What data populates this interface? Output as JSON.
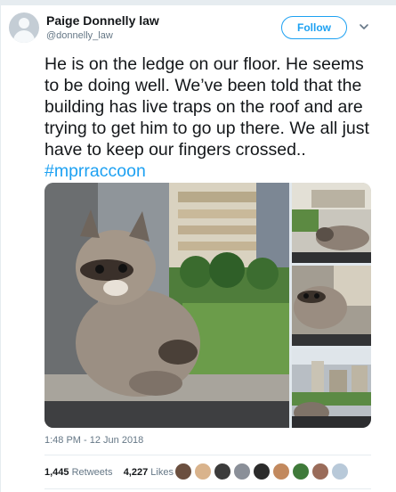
{
  "tweet": {
    "author_name": "Paige Donnelly law",
    "author_handle": "@donnelly_law",
    "follow_label": "Follow",
    "text": "He is on the ledge on our floor. He seems to be doing well. We’ve been told that the building has live traps on the roof and are trying to get him to go up there. We all just have to keep our fingers crossed..",
    "hashtag": "#mprraccoon",
    "timestamp": "1:48 PM - 12 Jun 2018",
    "retweets_count": "1,445",
    "retweets_label": "Retweets",
    "likes_count": "4,227",
    "likes_label": "Likes"
  },
  "icons": [
    "default-avatar-icon",
    "chevron-down-icon"
  ],
  "colors": {
    "accent": "#1da1f2",
    "text": "#14171a",
    "muted": "#657786",
    "divider": "#e6ecf0"
  },
  "liker_avatars": [
    "#6b4f3f",
    "#d9b38c",
    "#3b3b3b",
    "#8a8f98",
    "#2b2b2b",
    "#c2895e",
    "#3f7a3a",
    "#9a6c5a",
    "#b8c9d9"
  ]
}
